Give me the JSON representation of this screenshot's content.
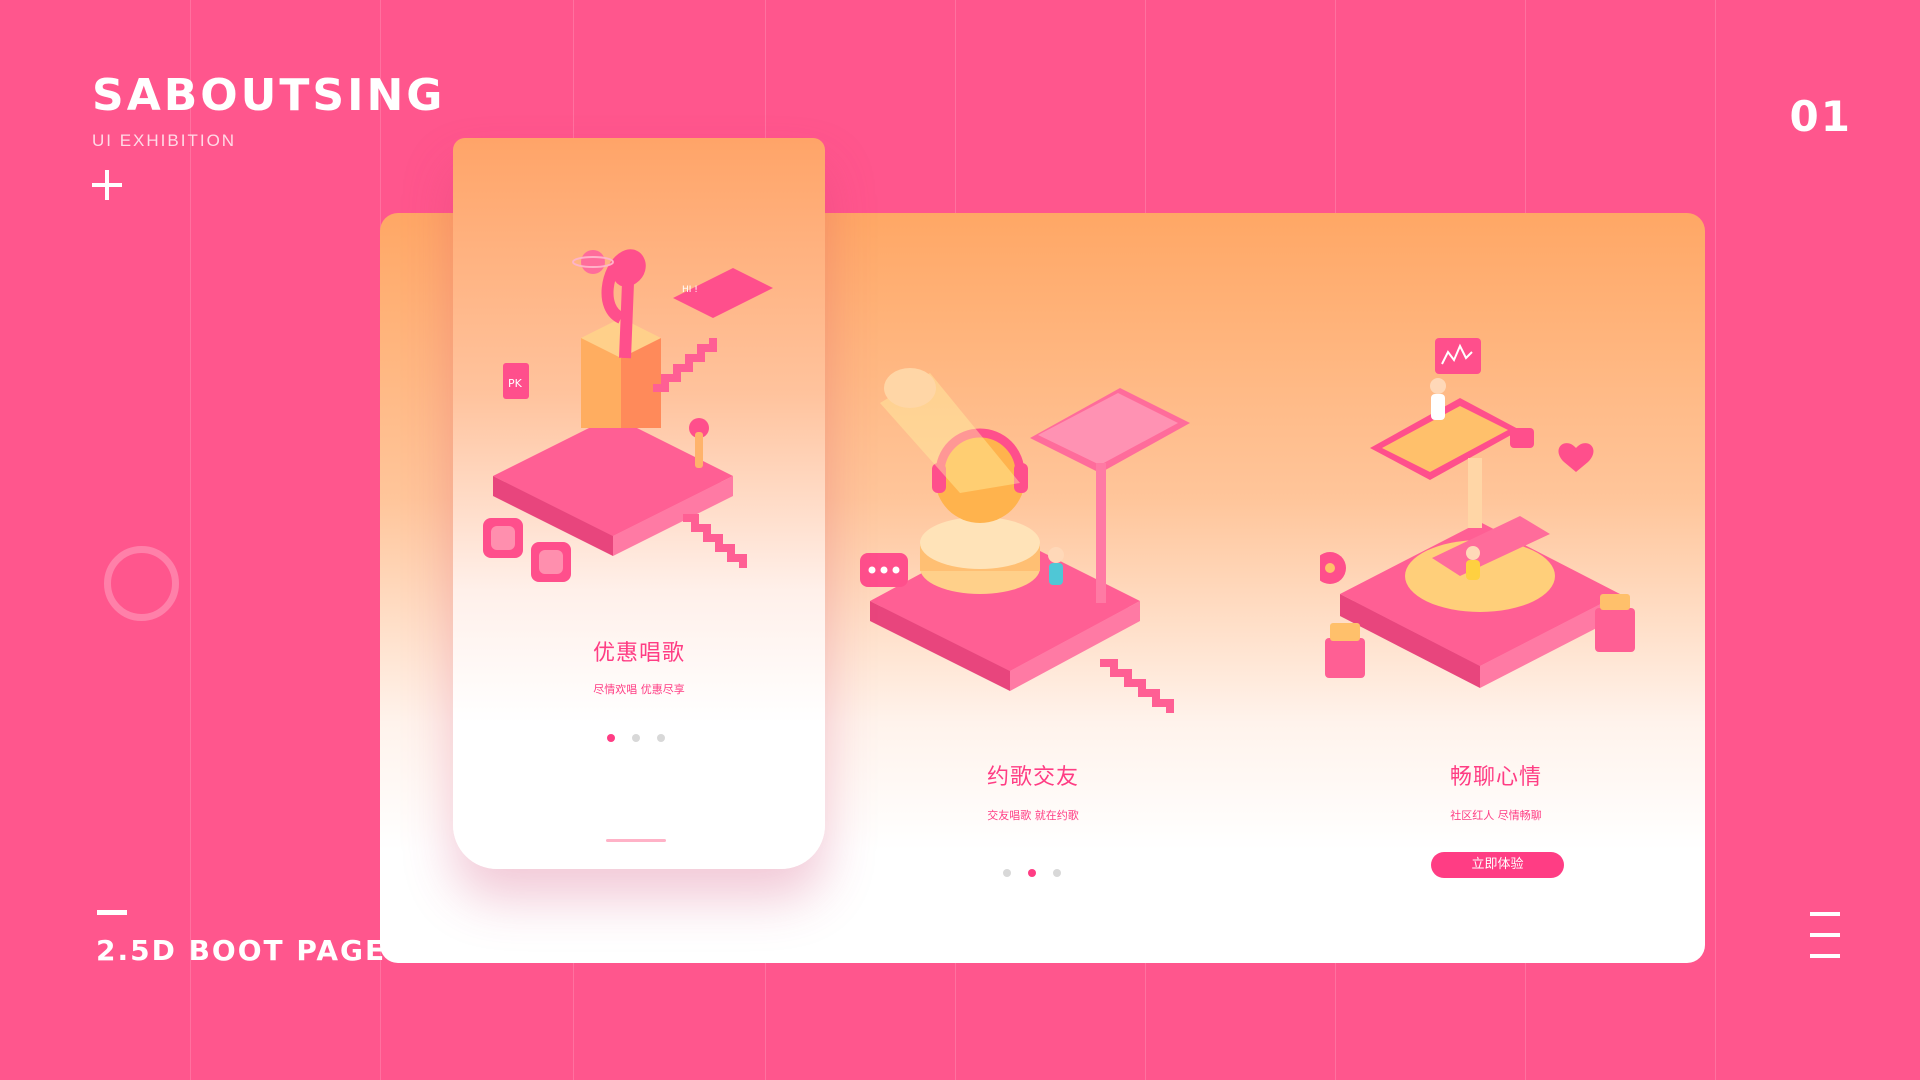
{
  "brand": {
    "title": "SABOUTSING",
    "subtitle": "UI  EXHIBITION"
  },
  "page_number": "01",
  "footer": {
    "title": "2.5D BOOT PAGE"
  },
  "screens": [
    {
      "title": "优惠唱歌",
      "subtitle": "尽情欢唱 优惠尽享",
      "active_dot": 0
    },
    {
      "title": "约歌交友",
      "subtitle": "交友唱歌 就在约歌",
      "active_dot": 1
    },
    {
      "title": "畅聊心情",
      "subtitle": "社区红人 尽情畅聊",
      "cta": "立即体验"
    }
  ],
  "illustration_labels": {
    "pk": "PK",
    "hi": "HI !"
  },
  "colors": {
    "background": "#ff568d",
    "accent": "#ff3d84",
    "board_top": "#ffa765",
    "white": "#ffffff"
  },
  "icons": [
    "plus-icon",
    "ring-icon",
    "dash-icon",
    "menu-icon",
    "music-note-icon",
    "heart-icon",
    "chat-bubble-icon",
    "headphones-icon"
  ]
}
